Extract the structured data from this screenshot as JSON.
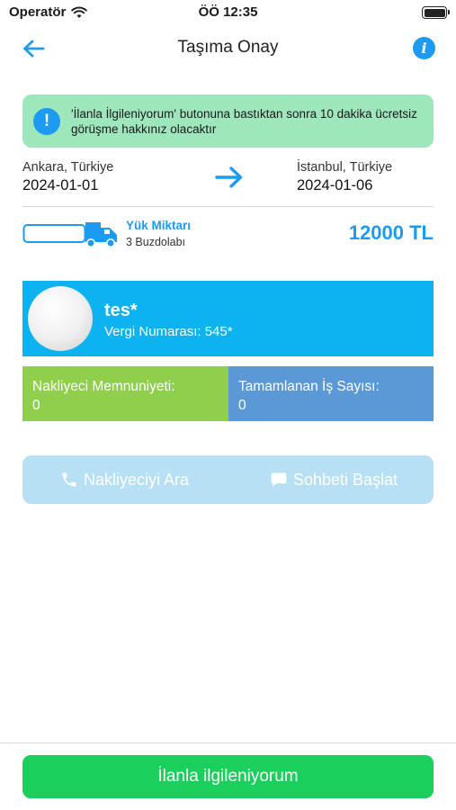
{
  "status_bar": {
    "carrier": "Operatör",
    "time": "ÖÖ 12:35"
  },
  "nav": {
    "title": "Taşıma Onay",
    "info_icon": "i"
  },
  "notice": {
    "icon": "!",
    "text": "'İlanla İlgileniyorum' butonuna bastıktan sonra 10 dakika ücretsiz görüşme hakkınız olacaktır"
  },
  "route": {
    "from": {
      "city": "Ankara, Türkiye",
      "date": "2024-01-01"
    },
    "to": {
      "city": "İstanbul, Türkiye",
      "date": "2024-01-06"
    }
  },
  "load": {
    "label": "Yük Miktarı",
    "value": "3 Buzdolabı",
    "price": "12000 TL"
  },
  "carrier": {
    "name": "tes*",
    "tax": "Vergi Numarası: 545*"
  },
  "stats": {
    "satisfaction_label": "Nakliyeci Memnuniyeti:",
    "satisfaction_value": "0",
    "jobs_label": "Tamamlanan İş Sayısı:",
    "jobs_value": "0"
  },
  "actions": {
    "call_label": "Nakliyeciyi Ara",
    "chat_label": "Sohbeti Başlat"
  },
  "cta": {
    "label": "İlanla ilgileniyorum"
  },
  "colors": {
    "accent": "#1d9bf0",
    "notice_bg": "#9ee6bb",
    "carrier_bg": "#0db2f0",
    "stat_green": "#8fcf4c",
    "stat_blue": "#5b99d6",
    "actions_bg": "#b7e0f4",
    "cta_bg": "#1bcf5c"
  }
}
